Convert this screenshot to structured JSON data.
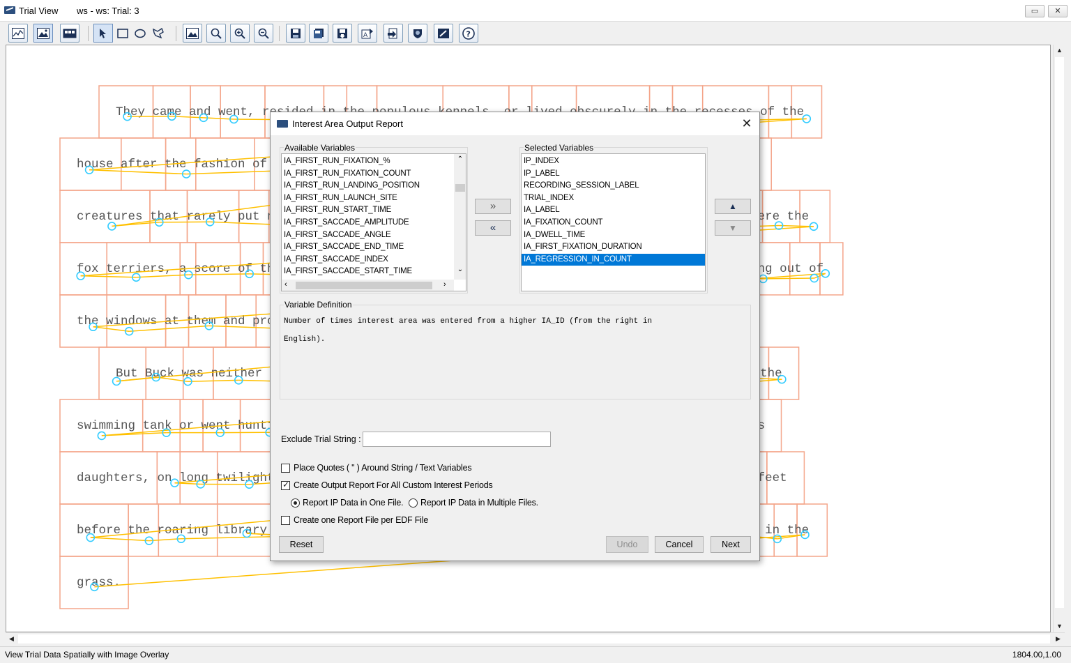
{
  "window": {
    "title": "Trial View",
    "subtitle": "ws - ws: Trial: 3",
    "restore_label": "▭",
    "close_label": "✕"
  },
  "toolbar": {
    "icons": [
      "temporal-graph-icon",
      "spatial-overlay-icon",
      "animation-playback-icon",
      "select-arrow-icon",
      "rectangle-icon",
      "ellipse-icon",
      "freehand-icon",
      "image-icon",
      "zoom-icon",
      "zoom-in-icon",
      "zoom-out-icon",
      "save-icon",
      "save-all-icon",
      "import-icon",
      "load-template-icon",
      "export-icon",
      "color-icon",
      "preferences-icon",
      "help-icon"
    ]
  },
  "reading_text": {
    "font": "monospace",
    "lines": [
      "They came and went, resided in the populous kennels, or lived obscurely in the recesses of the",
      "house after the fashion of Toots, the Japanese pug, or Ysabel, the Mexican hairless,--strange",
      "creatures that rarely put nose out of doors or set foot to ground. On the other hand, there were the",
      "fox terriers, a score of them at least, who yelped fearful promises at Toots and Ysabel looking out of",
      "the windows at them and protected by a legion of housemaids armed with brooms and mops.",
      "But Buck was neither house-dog nor kennel-dog. The whole realm was his. He plunged into the",
      "swimming tank or went hunting with the Judge's sons; he escorted Mollie and Alice, the Judge's",
      "daughters, on long twilight or early morning rambles; on wintry nights he lay at the Judge's feet",
      "before the roaring library fire; he carried the Judge's grandsons on his back, or rolled them in the",
      "grass."
    ]
  },
  "dialog": {
    "title": "Interest Area Output Report",
    "close_label": "✕",
    "available_label": "Available Variables",
    "available_items": [
      "IA_FIRST_RUN_FIXATION_%",
      "IA_FIRST_RUN_FIXATION_COUNT",
      "IA_FIRST_RUN_LANDING_POSITION",
      "IA_FIRST_RUN_LAUNCH_SITE",
      "IA_FIRST_RUN_START_TIME",
      "IA_FIRST_SACCADE_AMPLITUDE",
      "IA_FIRST_SACCADE_ANGLE",
      "IA_FIRST_SACCADE_END_TIME",
      "IA_FIRST_SACCADE_INDEX",
      "IA_FIRST_SACCADE_START_TIME"
    ],
    "selected_label": "Selected Variables",
    "selected_items": [
      "IP_INDEX",
      "IP_LABEL",
      "RECORDING_SESSION_LABEL",
      "TRIAL_INDEX",
      "IA_LABEL",
      "IA_FIXATION_COUNT",
      "IA_DWELL_TIME",
      "IA_FIRST_FIXATION_DURATION",
      "IA_REGRESSION_IN_COUNT"
    ],
    "selected_highlight": "IA_REGRESSION_IN_COUNT",
    "add_label": "»",
    "remove_label": "«",
    "move_up_label": "▲",
    "move_down_label": "▼",
    "definition_label": "Variable Definition",
    "definition_line1": "Number of times interest area was entered from a higher IA_ID (from the right in",
    "definition_line2": "English).",
    "exclude_label": "Exclude Trial String :",
    "exclude_value": "",
    "opt_quotes": "Place Quotes ( \" ) Around String / Text Variables",
    "opt_quotes_checked": false,
    "opt_custom_periods": "Create Output Report For All Custom Interest Periods",
    "opt_custom_periods_checked": true,
    "radio_one_file": "Report IP Data in One File.",
    "radio_multi_files": "Report IP Data in Multiple Files.",
    "radio_selected": "one",
    "opt_per_edf": "Create one Report File per EDF File",
    "opt_per_edf_checked": false,
    "reset_label": "Reset",
    "undo_label": "Undo",
    "cancel_label": "Cancel",
    "next_label": "Next"
  },
  "status": {
    "message": "View Trial Data Spatially with Image Overlay",
    "coordinates": "1804.00,1.00"
  },
  "colors": {
    "ia_border": "#f4a58a",
    "saccade": "#ffc000",
    "fixation": "#33ccff",
    "selection": "#0078d7"
  }
}
